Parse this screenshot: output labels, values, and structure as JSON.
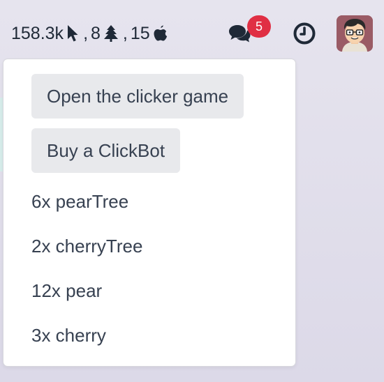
{
  "topbar": {
    "clicks": "158.3k",
    "clicks_icon": "mouse-pointer-icon",
    "sep1": ",",
    "trees": "8",
    "trees_icon": "tree-icon",
    "sep2": ",",
    "fruits": "15",
    "fruits_icon": "apple-icon",
    "chat_icon": "comments-icon",
    "chat_badge": "5",
    "clock_icon": "clock-icon",
    "avatar": "user-avatar"
  },
  "dropdown": {
    "open_game_label": "Open the clicker game",
    "buy_clickbot_label": "Buy a ClickBot",
    "items": [
      "6x pearTree",
      "2x cherryTree",
      "12x pear",
      "3x cherry"
    ]
  },
  "colors": {
    "badge": "#e02f44",
    "button_bg": "#e8e9ec",
    "text": "#374151"
  }
}
